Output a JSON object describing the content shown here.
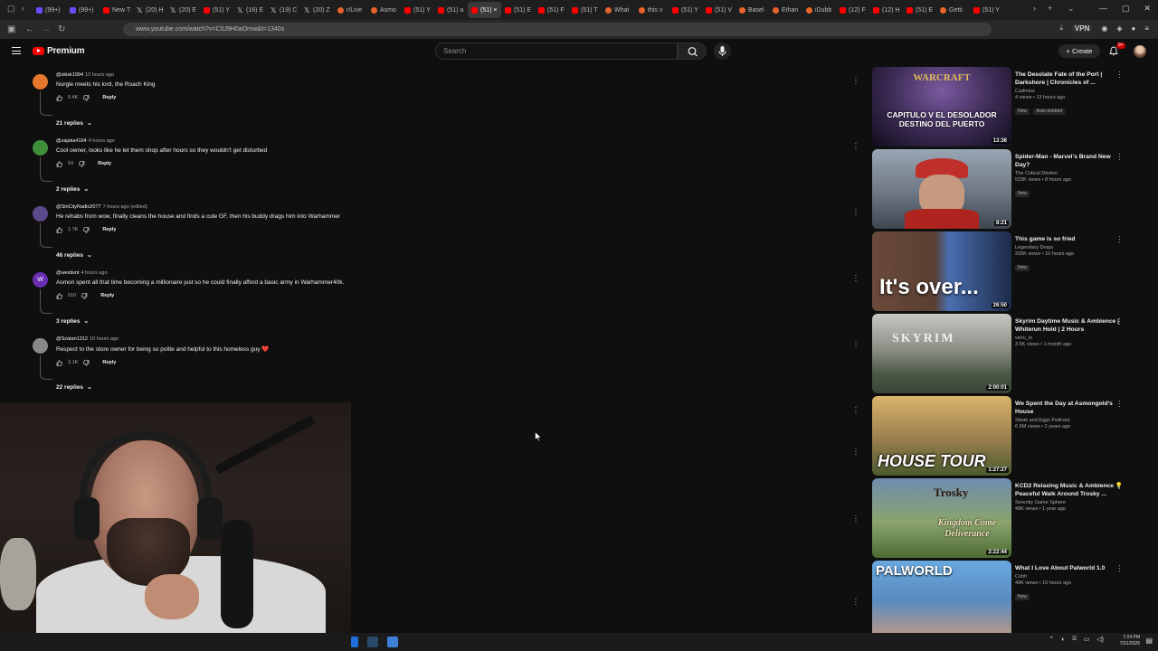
{
  "browser": {
    "tabs": [
      "(99+)",
      "(99+)",
      "New T",
      "(20) H",
      "(20) E",
      "(51) Y",
      "(16) E",
      "(19) C",
      "(20) Z",
      "r/Live",
      "Asmo",
      "(51) Y",
      "(51) a",
      "(51) ×",
      "(51) E",
      "(51) F",
      "(51) T",
      "What",
      "this v",
      "(51) Y",
      "(51) V",
      "Basel",
      "Ethan",
      "iDubb",
      "(12) F",
      "(12) H",
      "(51) E",
      "Getti",
      "(51) Y"
    ],
    "active_tab_index": 13,
    "url": "www.youtube.com/watch?v=C0J9H0aOrnw&t=1340s",
    "vpn_label": "VPN"
  },
  "header": {
    "logo_text": "Premium",
    "search_placeholder": "Search",
    "create_label": "Create",
    "notification_badge": "9+"
  },
  "comments": [
    {
      "user": "@skisk1994",
      "time": "10 hours ago",
      "text": "Nurgle meets his lord, the Roach King",
      "likes": "5.4K",
      "reply_label": "Reply",
      "replies": "21 replies",
      "avatar_color": "#e8772e"
    },
    {
      "user": "@zajaka4164",
      "time": "4 hours ago",
      "text": "Cool owner, looks like he let them shop after hours so they wouldn't get disturbed",
      "likes": "54",
      "reply_label": "Reply",
      "replies": "2 replies",
      "avatar_color": "#3f8f3a"
    },
    {
      "user": "@SinCityRadio2077",
      "time": "7 hours ago (edited)",
      "text": "He rehabs from wow, finally cleans the house and finds a cute GF, then his buddy drags him into Warhammer",
      "likes": "1.7K",
      "reply_label": "Reply",
      "replies": "46 replies",
      "avatar_color": "#5b4a8a"
    },
    {
      "user": "@westisnt",
      "time": "4 hours ago",
      "text": "Asmon spent all that time becoming a millionaire just so he could finally afford a basic army in Warhammer40k.",
      "likes": "510",
      "reply_label": "Reply",
      "replies": "3 replies",
      "avatar_color": "#6a2fb0",
      "avatar_letter": "W"
    },
    {
      "user": "@Szatan1312",
      "time": "10 hours ago",
      "text": "Respect to the store owner for being so polite and helpful to this homeless guy ❤️",
      "likes": "3.1K",
      "reply_label": "Reply",
      "replies": "22 replies",
      "avatar_color": "#888888"
    }
  ],
  "videos": [
    {
      "title": "The Desolate Fate of the Port | Darkshore | Chronicles of ...",
      "channel": "Cadmius",
      "stats": "4 views • 13 hours ago",
      "badges": [
        "New",
        "Auto-dubbed"
      ],
      "duration": "13:36",
      "thumb_text": "CAPITULO V EL DESOLADOR DESTINO DEL PUERTO",
      "thumb_logo": "WARCRAFT"
    },
    {
      "title": "Spider-Man - Marvel's Brand New Day?",
      "channel": "The Critical Drinker",
      "stats": "533K views • 8 hours ago",
      "badges": [
        "New"
      ],
      "duration": "8:21"
    },
    {
      "title": "This game is so fried",
      "channel": "Legendary Drops",
      "stats": "205K views • 10 hours ago",
      "badges": [
        "New"
      ],
      "duration": "26:50",
      "thumb_text": "It's over..."
    },
    {
      "title": "Skyrim Daytime Music & Ambience | Whiterun Hold | 2 Hours",
      "channel": "venv_io",
      "stats": "3.5K views • 1 month ago",
      "badges": [],
      "duration": "2:00:01",
      "thumb_text": "SKYRIM"
    },
    {
      "title": "We Spent the Day at Asmongold's House",
      "channel": "Steak and Eggs Podcast",
      "stats": "6.6M views • 2 years ago",
      "badges": [],
      "duration": "1:27:27",
      "thumb_text": "HOUSE TOUR"
    },
    {
      "title": "KCD2 Relaxing Music & Ambience 💡 Peaceful Walk Around Trosky ...",
      "channel": "Serenity Game Sphere",
      "stats": "48K views • 1 year ago",
      "badges": [],
      "duration": "2:22:44",
      "thumb_text": "Trosky",
      "thumb_text2": "Kingdom Come Deliverance"
    },
    {
      "title": "What I Love About Palworld 1.0",
      "channel": "Cohh",
      "stats": "49K views • 10 hours ago",
      "badges": [
        "New"
      ],
      "duration": "",
      "thumb_text": "PALWORLD"
    }
  ],
  "taskbar": {
    "time": "7:24 PM",
    "date": "7/31/2026"
  }
}
